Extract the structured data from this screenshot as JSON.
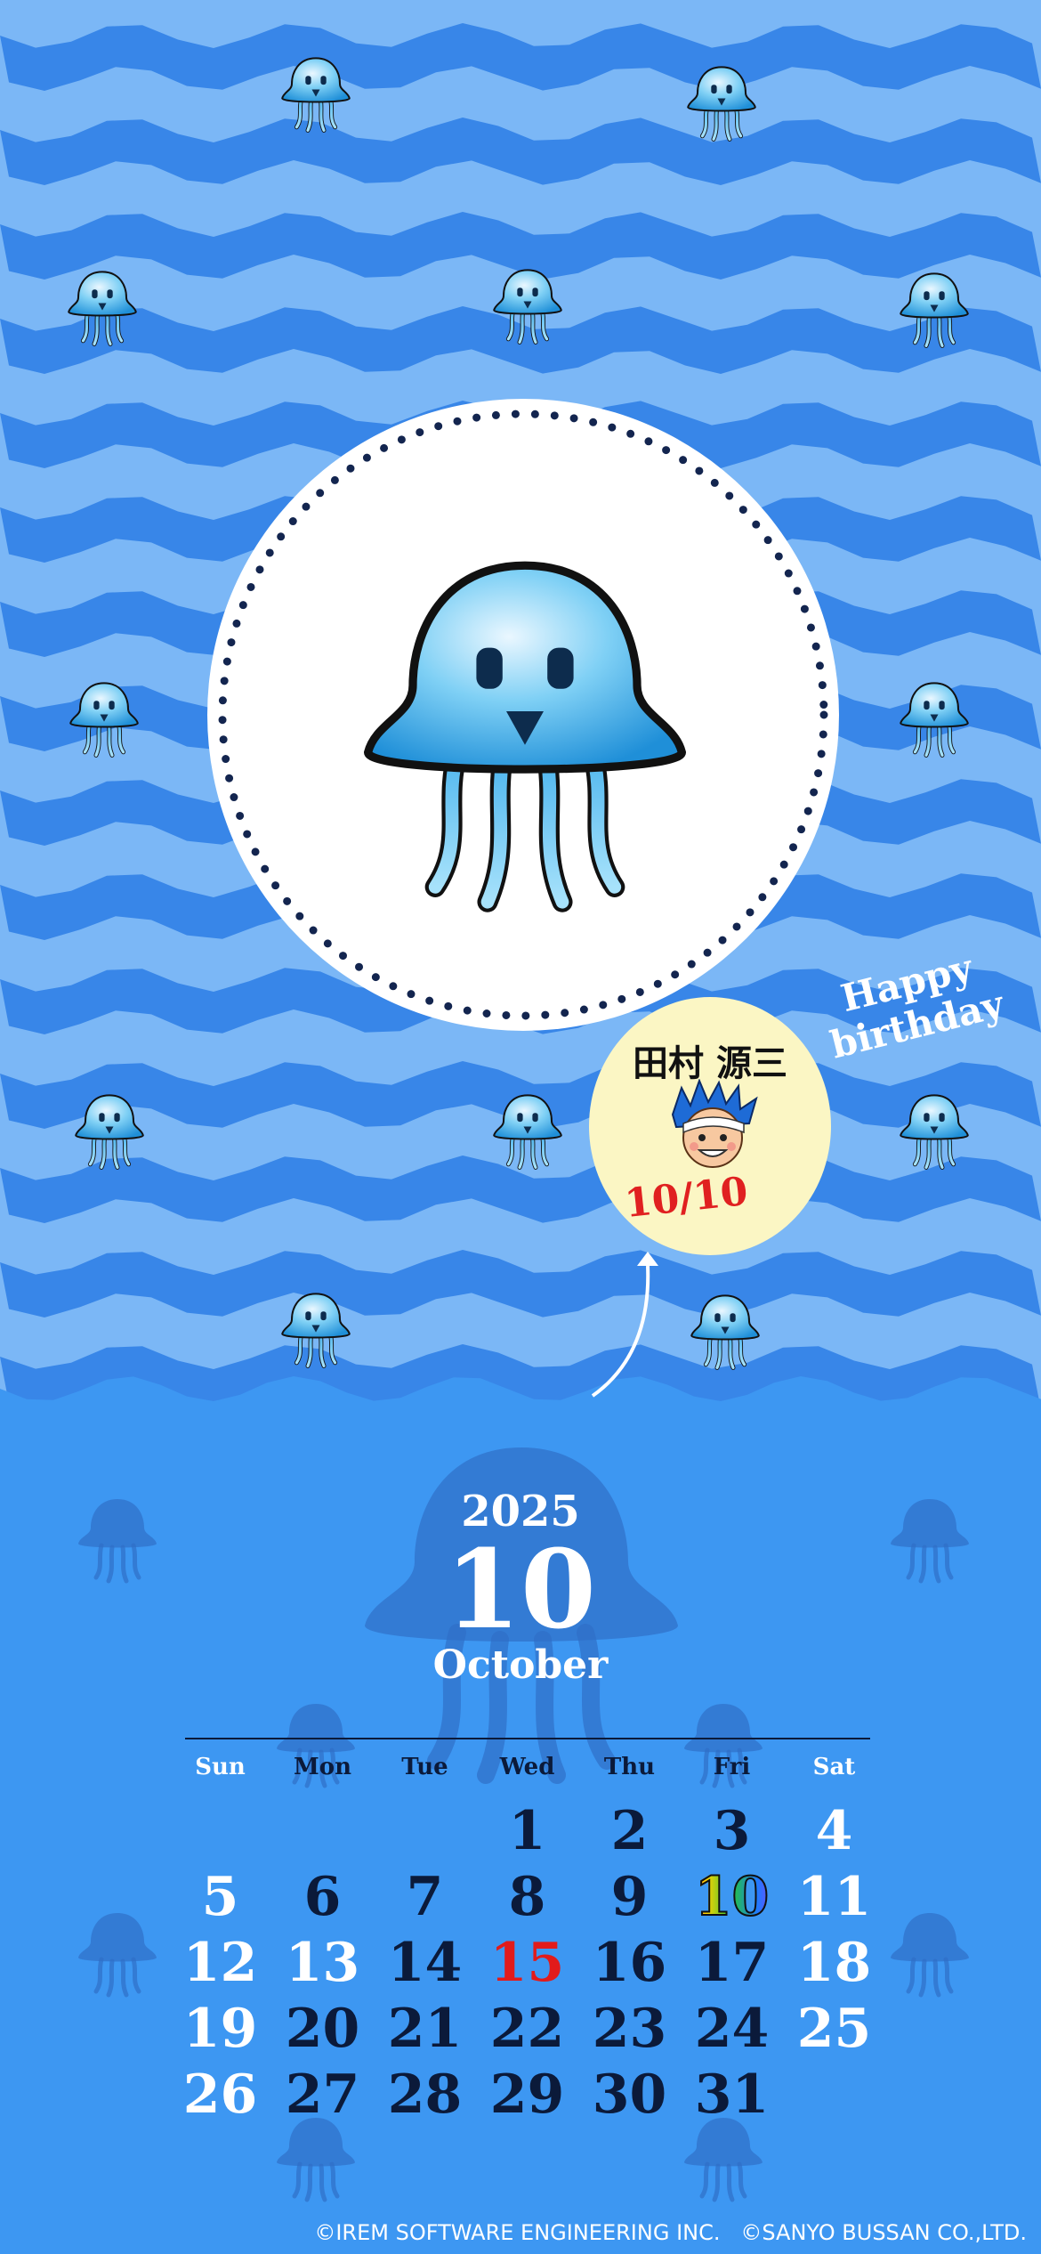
{
  "colors": {
    "wave_light": "#7bb7f6",
    "wave_dark": "#3886e8",
    "bottom_bg": "#3d97f2",
    "shadow": "#2f6fc7",
    "weekday_text": "#0b1a3a",
    "weekend_text": "#ffffff",
    "holiday_text": "#e21b1b"
  },
  "birthday": {
    "greeting": "Happy birthday",
    "name": "田村 源三",
    "date": "10/10"
  },
  "calendar": {
    "year": "2025",
    "month_number": "10",
    "month_name": "October",
    "weekdays": [
      "Sun",
      "Mon",
      "Tue",
      "Wed",
      "Thu",
      "Fri",
      "Sat"
    ],
    "weeks": [
      [
        "",
        "",
        "",
        "1",
        "2",
        "3",
        "4"
      ],
      [
        "5",
        "6",
        "7",
        "8",
        "9",
        "10",
        "11"
      ],
      [
        "12",
        "13",
        "14",
        "15",
        "16",
        "17",
        "18"
      ],
      [
        "19",
        "20",
        "21",
        "22",
        "23",
        "24",
        "25"
      ],
      [
        "26",
        "27",
        "28",
        "29",
        "30",
        "31",
        ""
      ]
    ],
    "holidays": [
      "13"
    ],
    "highlight_red": [
      "15"
    ],
    "birthday_day": "10"
  },
  "footer": {
    "copyright": "©IREM SOFTWARE ENGINEERING INC.   ©SANYO BUSSAN CO.,LTD."
  }
}
